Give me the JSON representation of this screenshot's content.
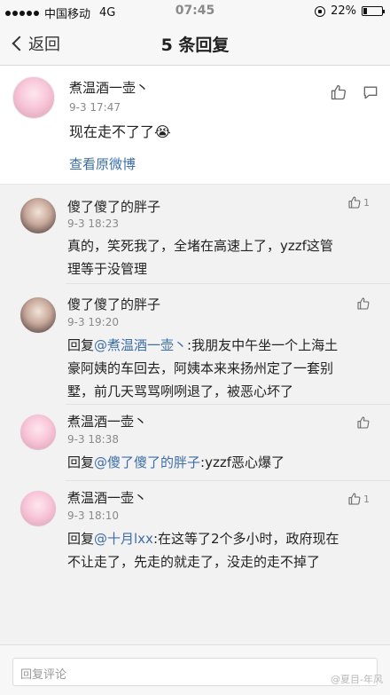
{
  "status_bar": {
    "carrier": "中国移动",
    "network": "4G",
    "time": "07:45",
    "battery": "22%",
    "battery_level": 0.22
  },
  "nav": {
    "back_label": "返回",
    "title": "5 条回复"
  },
  "main_post": {
    "author": "煮温酒一壶丶",
    "time": "9-3 17:47",
    "text": "现在走不了了",
    "emoji": "😭",
    "view_original": "查看原微博"
  },
  "comments": [
    {
      "author": "傻了傻了的胖子",
      "time": "9-3 18:23",
      "line1": "真的，笑死我了，全堵在高速上了，yzzf这管",
      "line2": "理等于没管理"
    },
    {
      "author": "傻了傻了的胖子",
      "time": "9-3 19:20",
      "reply_prefix": "回复",
      "reply_mention": "@煮温酒一壶丶",
      "line1_rest": ":我朋友中午坐一个上海土",
      "line2": "豪阿姨的车回去，阿姨本来来扬州定了一套别",
      "line3": "墅，前几天骂骂咧咧退了，被恶心坏了"
    },
    {
      "author": "煮温酒一壶丶",
      "time": "9-3 18:38",
      "reply_prefix": "回复",
      "reply_mention": "@傻了傻了的胖子",
      "line1_rest": ":yzzf恶心爆了"
    },
    {
      "author": "煮温酒一壶丶",
      "time": "9-3 18:10",
      "reply_prefix": "回复",
      "reply_mention": "@十月lxx",
      "line1_rest": ":在这等了2个多小时，政府现在",
      "line2": "不让走了，先走的就走了，没走的走不掉了"
    }
  ],
  "bottom_bar": {
    "placeholder": "回复评论",
    "watermark": "@夏目-年风"
  },
  "icons": {
    "like": "thumbs-up-icon",
    "comment": "speech-bubble-icon",
    "back": "chevron-left-icon"
  },
  "colors": {
    "link": "#3d6ea8",
    "background": "#f2f2f2"
  }
}
